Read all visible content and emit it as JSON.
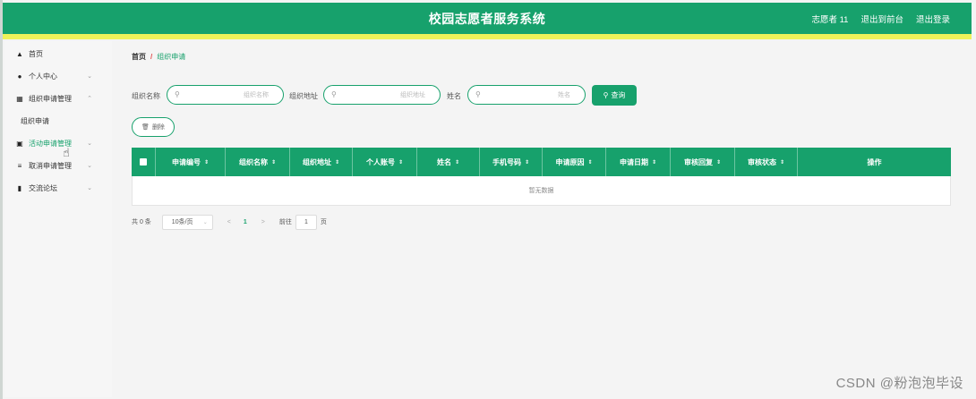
{
  "header": {
    "title": "校园志愿者服务系统",
    "user": "志愿者 11",
    "to_front": "退出到前台",
    "logout": "退出登录"
  },
  "sidebar": {
    "items": [
      {
        "label": "首页",
        "icon": "home-icon"
      },
      {
        "label": "个人中心",
        "icon": "user-icon"
      },
      {
        "label": "组织申请管理",
        "icon": "grid-icon"
      },
      {
        "label": "组织申请",
        "icon": ""
      },
      {
        "label": "活动申请管理",
        "icon": "clipboard-icon"
      },
      {
        "label": "取消申请管理",
        "icon": "list-icon"
      },
      {
        "label": "交流论坛",
        "icon": "bar-chart-icon"
      }
    ]
  },
  "breadcrumb": {
    "home": "首页",
    "separator": "/",
    "current": "组织申请"
  },
  "search": {
    "org_name_label": "组织名称",
    "org_name_placeholder": "组织名称",
    "org_addr_label": "组织地址",
    "org_addr_placeholder": "组织地址",
    "name_label": "姓名",
    "name_placeholder": "姓名",
    "search_button": "查询"
  },
  "delete_button": "删除",
  "table": {
    "columns": [
      "申请编号",
      "组织名称",
      "组织地址",
      "个人账号",
      "姓名",
      "手机号码",
      "申请原因",
      "申请日期",
      "审核回复",
      "审核状态",
      "操作"
    ],
    "empty_text": "暂无数据"
  },
  "pagination": {
    "total": "共 0 条",
    "page_size": "10条/页",
    "prev": "<",
    "current_page": "1",
    "next": ">",
    "goto_label": "前往",
    "goto_value": "1",
    "page_unit": "页"
  },
  "watermark": "CSDN @粉泡泡毕设",
  "colors": {
    "primary": "#17a16c",
    "accent_bar": "#eef15a",
    "breadcrumb_separator": "#e05050"
  }
}
